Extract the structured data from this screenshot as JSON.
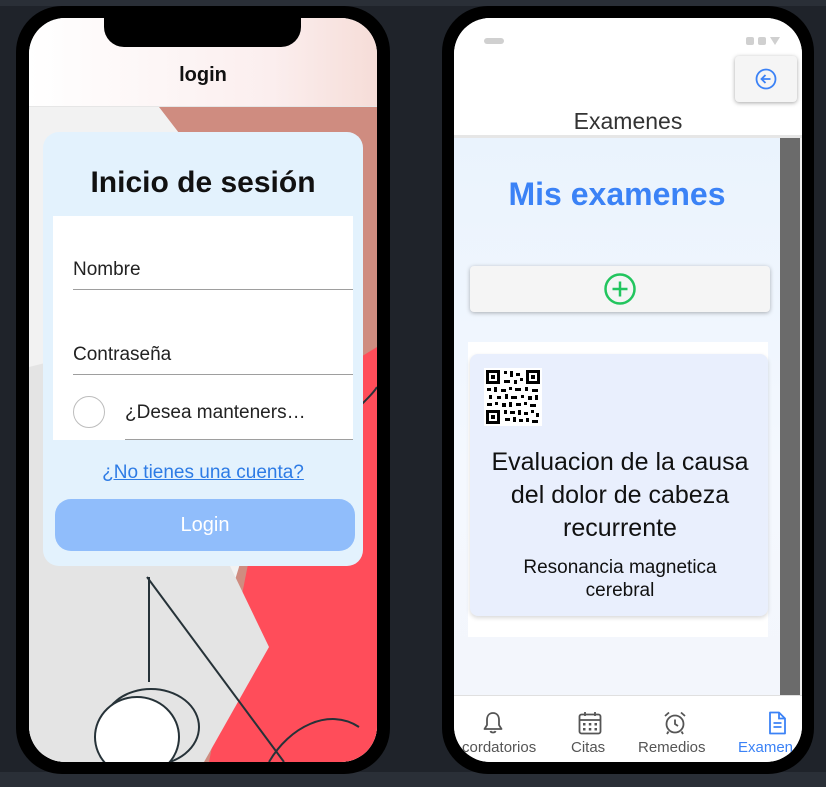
{
  "left_phone": {
    "header_title": "login",
    "heading": "Inicio de sesión",
    "username_placeholder": "Nombre",
    "password_placeholder": "Contraseña",
    "remember_label": "¿Desea manteners…",
    "signup_link": "¿No tienes una cuenta?",
    "login_button": "Login"
  },
  "right_phone": {
    "header_title": "Examenes",
    "back_icon": "arrow-left-circle-icon",
    "page_title": "Mis examenes",
    "add_icon": "plus-circle-icon",
    "exam": {
      "title": "Evaluacion de la causa del dolor de cabeza recurrente",
      "subtitle": "Resonancia magnetica cerebral"
    },
    "tabs": [
      {
        "label": "Recordatorios",
        "visible_label": "cordatorios",
        "icon": "bell-icon",
        "active": false
      },
      {
        "label": "Citas",
        "icon": "calendar-icon",
        "active": false
      },
      {
        "label": "Remedios",
        "icon": "alarm-clock-icon",
        "active": false
      },
      {
        "label": "Examenes",
        "visible_label": "Examen",
        "icon": "document-icon",
        "active": true
      }
    ]
  },
  "colors": {
    "accent": "#3b82f6",
    "login_button": "#90bdfb",
    "card_background": "#e3f2fd",
    "add_icon": "#22c55e",
    "art_red": "#ff4d5a"
  }
}
